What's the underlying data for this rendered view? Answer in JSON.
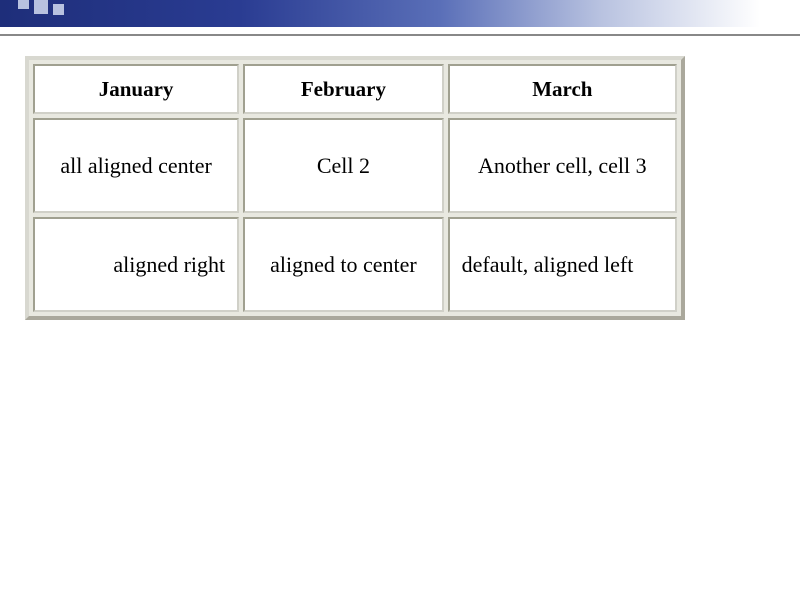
{
  "table": {
    "headers": [
      "January",
      "February",
      "March"
    ],
    "rows": [
      {
        "cells": [
          "all aligned center",
          "Cell 2",
          "Another cell, cell 3"
        ],
        "aligns": [
          "center",
          "center",
          "center"
        ]
      },
      {
        "cells": [
          "aligned right",
          "aligned to center",
          "default, aligned left"
        ],
        "aligns": [
          "right",
          "center",
          "left"
        ]
      }
    ]
  }
}
